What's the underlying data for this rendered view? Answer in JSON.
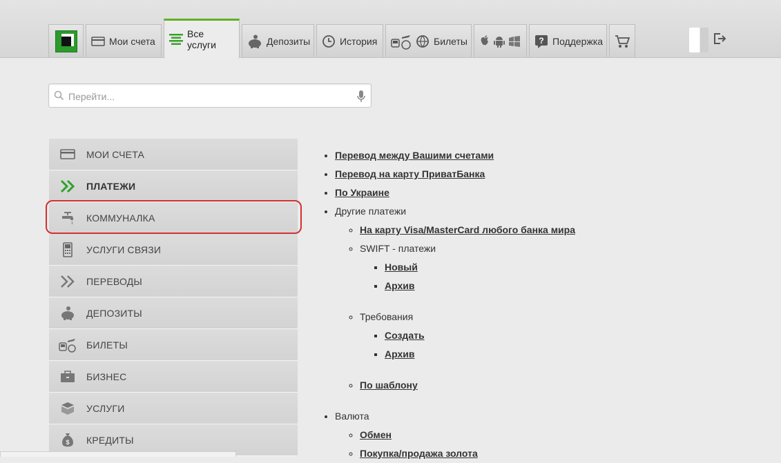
{
  "topnav": {
    "tabs": [
      {
        "label": "Мои счета",
        "icon": "card-icon"
      },
      {
        "label": "Все услуги",
        "icon": "list-icon"
      },
      {
        "label": "Депозиты",
        "icon": "piggy-bank-icon"
      },
      {
        "label": "История",
        "icon": "history-icon"
      },
      {
        "label": "Билеты",
        "icon": "tickets-icon"
      },
      {
        "label": "Поддержка",
        "icon": "support-icon"
      }
    ],
    "accent_color": "#5fb022"
  },
  "search": {
    "placeholder": "Перейти..."
  },
  "sidebar": {
    "items": [
      {
        "label": "МОИ СЧЕТА",
        "icon": "card-icon"
      },
      {
        "label": "ПЛАТЕЖИ",
        "icon": "double-chevron-icon"
      },
      {
        "label": "КОММУНАЛКА",
        "icon": "faucet-icon"
      },
      {
        "label": "УСЛУГИ СВЯЗИ",
        "icon": "phone-icon"
      },
      {
        "label": "ПЕРЕВОДЫ",
        "icon": "double-chevron-icon"
      },
      {
        "label": "ДЕПОЗИТЫ",
        "icon": "piggy-bank-icon"
      },
      {
        "label": "БИЛЕТЫ",
        "icon": "tickets-icon"
      },
      {
        "label": "БИЗНЕС",
        "icon": "briefcase-icon"
      },
      {
        "label": "УСЛУГИ",
        "icon": "box-icon"
      },
      {
        "label": "КРЕДИТЫ",
        "icon": "money-bag-icon"
      }
    ],
    "highlight_color": "#d32f2f"
  },
  "content": {
    "transfer_own": "Перевод между Вашими счетами",
    "transfer_privat": "Перевод на карту ПриватБанка",
    "ukraine": "По Украине",
    "other": "Другие платежи",
    "visa_mc": "На карту Visa/MasterCard любого банка мира",
    "swift": "SWIFT - платежи",
    "swift_new": "Новый",
    "swift_archive": "Архив",
    "requirements": "Требования",
    "req_create": "Создать",
    "req_archive": "Архив",
    "by_template": "По шаблону",
    "currency": "Валюта",
    "exchange": "Обмен",
    "gold": "Покупка/продажа золота"
  }
}
